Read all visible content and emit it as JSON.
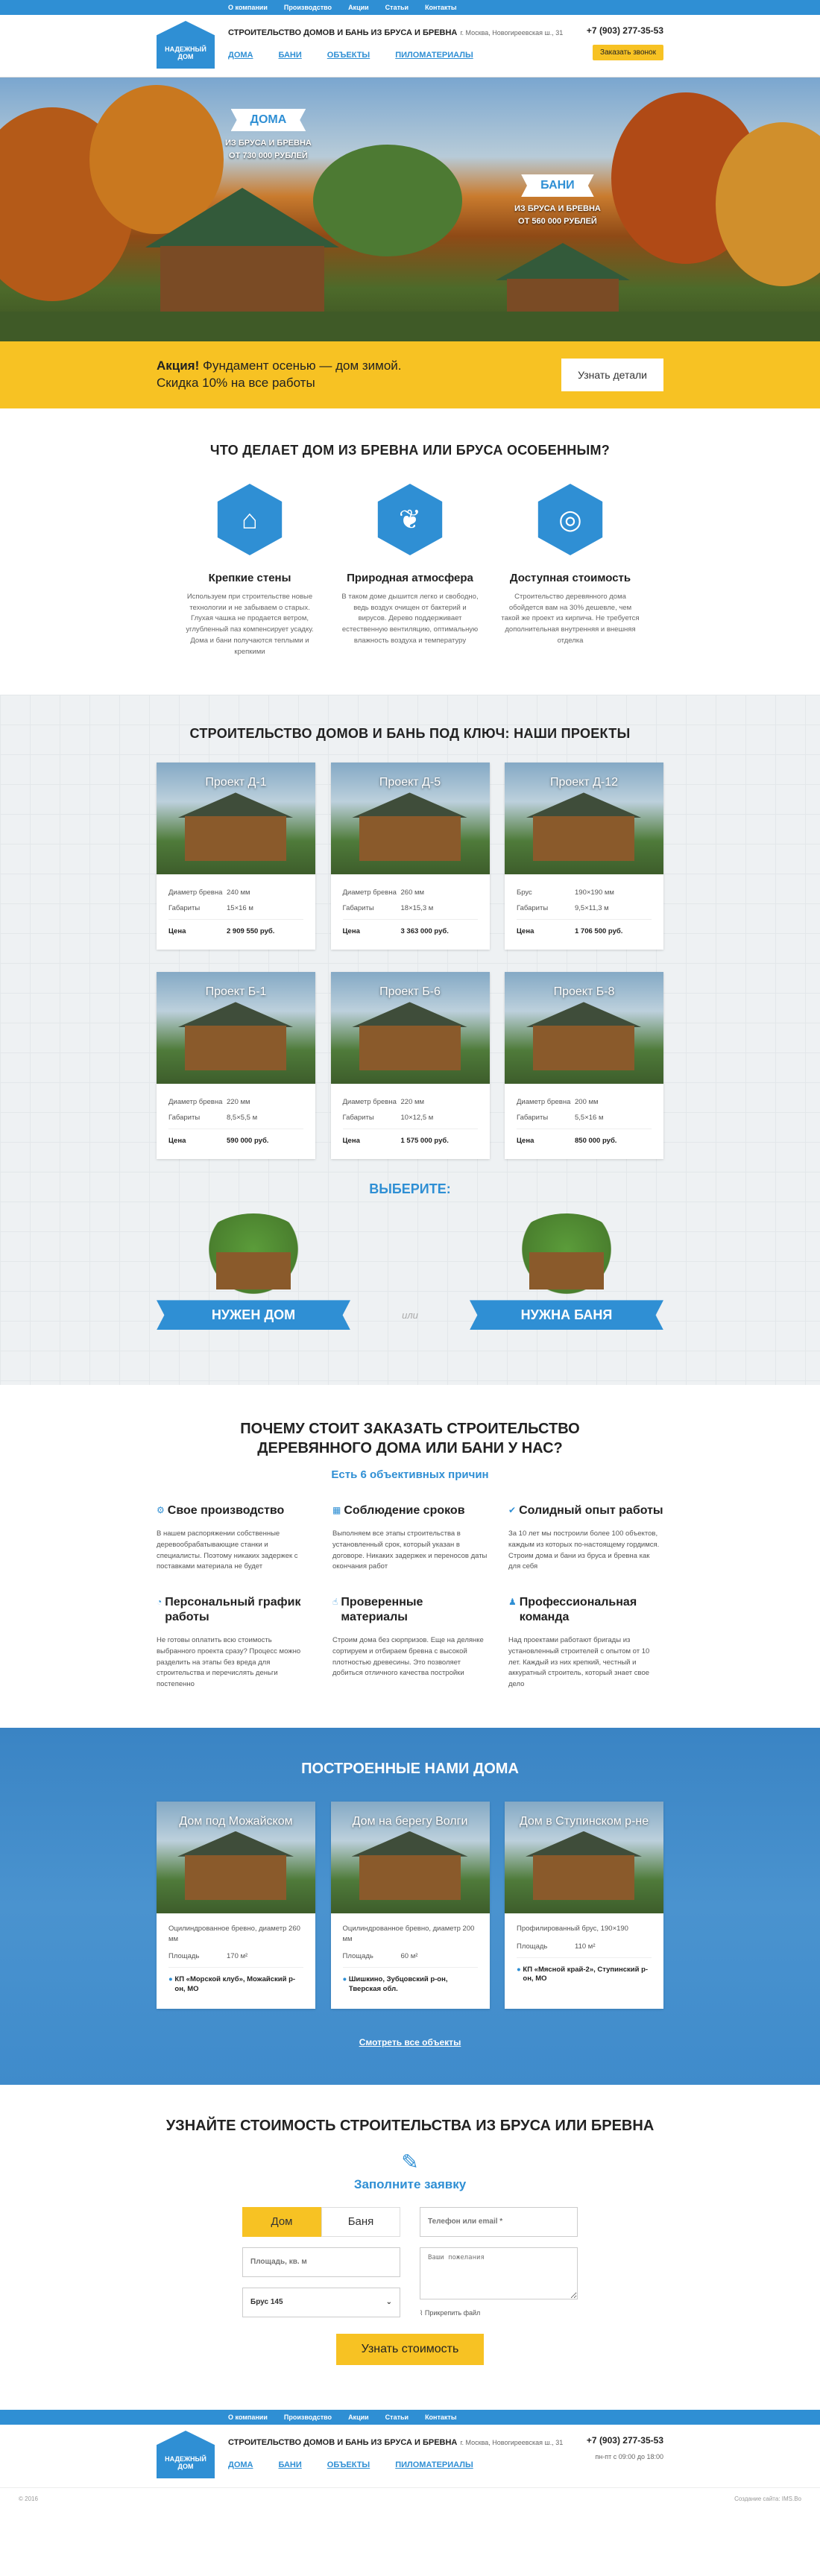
{
  "topnav": [
    "О компании",
    "Производство",
    "Акции",
    "Статьи",
    "Контакты"
  ],
  "header": {
    "logo": "НАДЕЖНЫЙ ДОМ",
    "title": "СТРОИТЕЛЬСТВО ДОМОВ И БАНЬ ИЗ БРУСА И БРЕВНА",
    "address": "г. Москва, Новогиреевская ш., 31",
    "nav": [
      "ДОМА",
      "БАНИ",
      "ОБЪЕКТЫ",
      "ПИЛОМАТЕРИАЛЫ"
    ],
    "phone": "+7 (903) 277-35-53",
    "call_button": "Заказать звонок"
  },
  "hero": {
    "houses": {
      "tag": "ДОМА",
      "line1": "ИЗ БРУСА И БРЕВНА",
      "line2": "ОТ 730 000 РУБЛЕЙ"
    },
    "baths": {
      "tag": "БАНИ",
      "line1": "ИЗ БРУСА И БРЕВНА",
      "line2": "ОТ 560 000 РУБЛЕЙ"
    }
  },
  "promo": {
    "bold": "Акция!",
    "text1": "Фундамент осенью — дом зимой.",
    "text2": "Скидка 10% на все работы",
    "button": "Узнать детали"
  },
  "features": {
    "title": "ЧТО ДЕЛАЕТ ДОМ ИЗ БРЕВНА ИЛИ БРУСА ОСОБЕННЫМ?",
    "items": [
      {
        "icon": "house-icon",
        "glyph": "⌂",
        "title": "Крепкие стены",
        "text": "Используем при строительстве новые технологии и не забываем о старых. Глухая чашка не продается ветром, углубленный паз компенсирует усадку. Дома и бани получаются теплыми и крепкими"
      },
      {
        "icon": "leaf-icon",
        "glyph": "❦",
        "title": "Природная атмосфера",
        "text": "В таком доме дышится легко и свободно, ведь воздух очищен от бактерий и вирусов. Дерево поддерживает естественную вентиляцию, оптимальную влажность воздуха и температуру"
      },
      {
        "icon": "coins-icon",
        "glyph": "◎",
        "title": "Доступная стоимость",
        "text": "Строительство деревянного дома обойдется вам на 30% дешевле, чем такой же проект из кирпича. Не требуется дополнительная внутренняя и внешняя отделка"
      }
    ]
  },
  "projects": {
    "title": "СТРОИТЕЛЬСТВО ДОМОВ И БАНЬ ПОД КЛЮЧ: НАШИ ПРОЕКТЫ",
    "price_label": "Цена",
    "items": [
      {
        "name": "Проект Д-1",
        "spec1_label": "Диаметр бревна",
        "spec1": "240 мм",
        "spec2_label": "Габариты",
        "spec2": "15×16 м",
        "price": "2 909 550 руб."
      },
      {
        "name": "Проект Д-5",
        "spec1_label": "Диаметр бревна",
        "spec1": "260 мм",
        "spec2_label": "Габариты",
        "spec2": "18×15,3 м",
        "price": "3 363 000 руб."
      },
      {
        "name": "Проект Д-12",
        "spec1_label": "Брус",
        "spec1": "190×190 мм",
        "spec2_label": "Габариты",
        "spec2": "9,5×11,3 м",
        "price": "1 706 500 руб."
      },
      {
        "name": "Проект Б-1",
        "spec1_label": "Диаметр бревна",
        "spec1": "220 мм",
        "spec2_label": "Габариты",
        "spec2": "8,5×5,5 м",
        "price": "590 000 руб."
      },
      {
        "name": "Проект Б-6",
        "spec1_label": "Диаметр бревна",
        "spec1": "220 мм",
        "spec2_label": "Габариты",
        "spec2": "10×12,5 м",
        "price": "1 575 000 руб."
      },
      {
        "name": "Проект Б-8",
        "spec1_label": "Диаметр бревна",
        "spec1": "200 мм",
        "spec2_label": "Габариты",
        "spec2": "5,5×16 м",
        "price": "850 000 руб."
      }
    ],
    "choose": "ВЫБЕРИТЕ:",
    "need_house": "НУЖЕН ДОМ",
    "or": "или",
    "need_bath": "НУЖНА БАНЯ"
  },
  "why": {
    "title_line1": "ПОЧЕМУ СТОИТ ЗАКАЗАТЬ СТРОИТЕЛЬСТВО",
    "title_line2": "ДЕРЕВЯННОГО ДОМА ИЛИ БАНИ У НАС?",
    "subtitle": "Есть 6 объективных причин",
    "items": [
      {
        "icon": "gears-icon",
        "glyph": "⚙",
        "title": "Свое производство",
        "text": "В нашем распоряжении собственные деревообрабатывающие станки и специалисты. Поэтому никаких задержек с поставками материала не будет"
      },
      {
        "icon": "calendar-icon",
        "glyph": "▦",
        "title": "Соблюдение сроков",
        "text": "Выполняем все этапы строительства в установленный срок, который указан в договоре. Никаких задержек и переносов даты окончания работ"
      },
      {
        "icon": "check-icon",
        "glyph": "✔",
        "title": "Солидный опыт работы",
        "text": "За 10 лет мы построили более 100 объектов, каждым из которых по-настоящему гордимся. Строим дома и бани из бруса и бревна как для себя"
      },
      {
        "icon": "chart-icon",
        "glyph": "◔",
        "title": "Персональный график работы",
        "text": "Не готовы оплатить всю стоимость выбранного проекта сразу? Процесс можно разделить на этапы без вреда для строительства и перечислять деньги постепенно"
      },
      {
        "icon": "thumbs-up-icon",
        "glyph": "☝",
        "title": "Проверенные материалы",
        "text": "Строим дома без сюрпризов. Еще на делянке сортируем и отбираем бревна с высокой плотностью древесины. Это позволяет добиться отличного качества постройки"
      },
      {
        "icon": "team-icon",
        "glyph": "♟",
        "title": "Профессиональная команда",
        "text": "Над проектами работают бригады из установленный строителей с опытом от 10 лет. Каждый из них крепкий, честный и аккуратный строитель, который знает свое дело"
      }
    ]
  },
  "built": {
    "title": "ПОСТРОЕННЫЕ НАМИ ДОМА",
    "area_label": "Площадь",
    "items": [
      {
        "name": "Дом под Можайском",
        "desc": "Оцилиндрованное бревно, диаметр 260 мм",
        "area": "170 м²",
        "addr": "КП «Морской клуб», Можайский р-он, МО"
      },
      {
        "name": "Дом на берегу Волги",
        "desc": "Оцилиндрованное бревно, диаметр 200 мм",
        "area": "60 м²",
        "addr": "Шишкино, Зубцовский р-он, Тверская обл."
      },
      {
        "name": "Дом в Ступинском р-не",
        "desc": "Профилированный брус, 190×190",
        "area": "110 м²",
        "addr": "КП «Мясной край-2», Ступинский р-он, МО"
      }
    ],
    "all_link": "Смотреть все объекты"
  },
  "order": {
    "title": "УЗНАЙТЕ СТОИМОСТЬ СТРОИТЕЛЬСТВА ИЗ БРУСА ИЛИ БРЕВНА",
    "subtitle": "Заполните заявку",
    "tab_house": "Дом",
    "tab_bath": "Баня",
    "area_placeholder": "Площадь, кв. м",
    "material": "Брус 145",
    "contact_placeholder": "Телефон или email *",
    "wishes_placeholder": "Ваши пожелания",
    "attach": "Прикрепить файл",
    "submit": "Узнать стоимость"
  },
  "footer": {
    "copyright": "© 2016",
    "dev": "Создание сайта: IMS.Bo",
    "hours": "пн-пт с 09:00 до 18:00"
  }
}
